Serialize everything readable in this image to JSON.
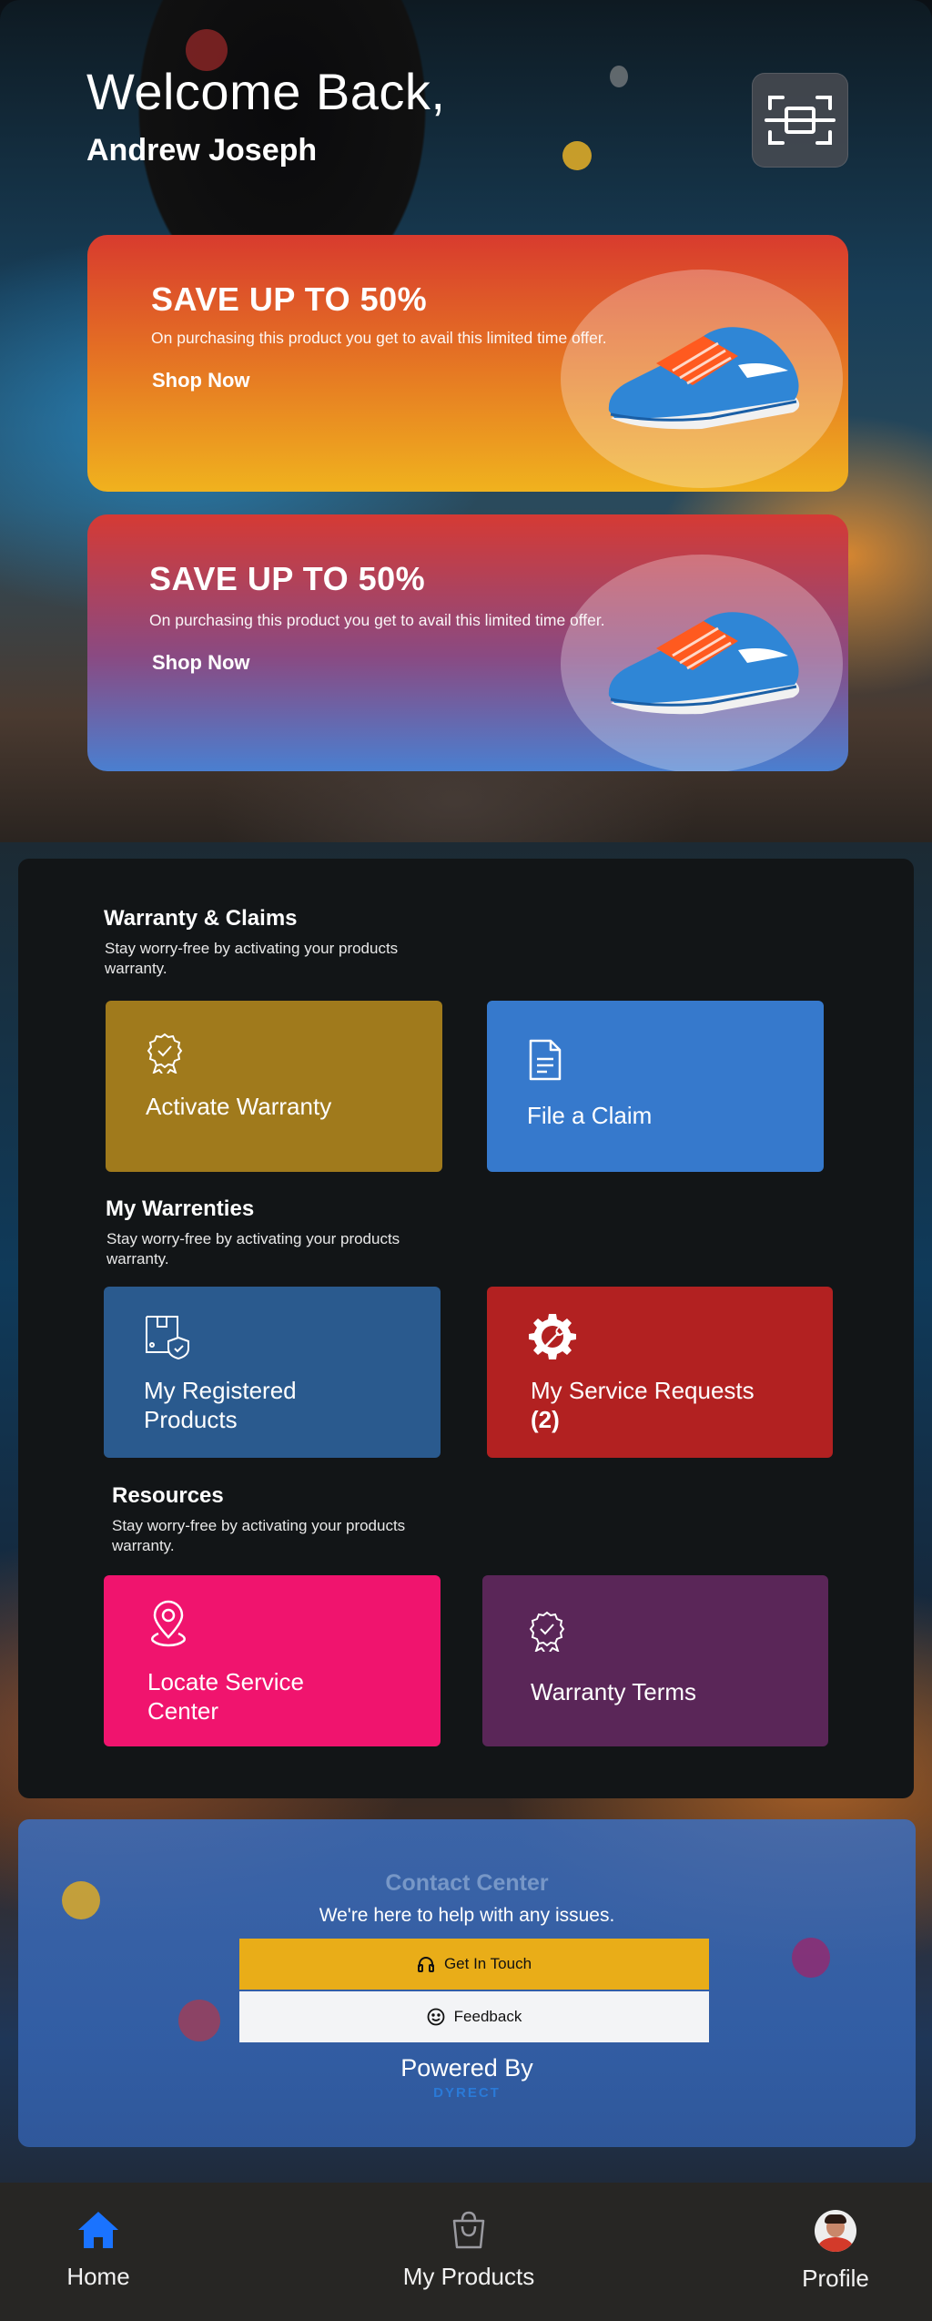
{
  "header": {
    "greeting": "Welcome Back,",
    "user_name": "Andrew Joseph",
    "scan_icon": "scan-icon"
  },
  "promos": [
    {
      "title": "SAVE UP TO 50%",
      "subtitle": "On purchasing this product you get to avail this limited time offer.",
      "cta": "Shop Now",
      "image": "running-shoe"
    },
    {
      "title": "SAVE UP TO 50%",
      "subtitle": "On purchasing this product you get to avail this limited time offer.",
      "cta": "Shop Now",
      "image": "running-shoe"
    }
  ],
  "warranty_claims": {
    "title": "Warranty & Claims",
    "subtitle": "Stay worry-free by activating your products warranty.",
    "tiles": [
      {
        "label": "Activate Warranty",
        "icon": "award-badge-icon",
        "color": "#a07a1c"
      },
      {
        "label": "File a Claim",
        "icon": "document-icon",
        "color": "#3679cc"
      }
    ]
  },
  "my_warranties": {
    "title": "My Warrenties",
    "subtitle": "Stay worry-free by activating your products warranty.",
    "tiles": [
      {
        "label": "My Registered Products",
        "icon": "box-shield-icon",
        "color": "#2a5a8e"
      },
      {
        "label_main": "My Service Requests",
        "label_count": "(2)",
        "icon": "gear-wrench-icon",
        "color": "#b22121"
      }
    ]
  },
  "resources": {
    "title": "Resources",
    "subtitle": "Stay worry-free by activating your products warranty.",
    "tiles": [
      {
        "label": "Locate Service Center",
        "icon": "map-pin-icon",
        "color": "#f0146e"
      },
      {
        "label": "Warranty Terms",
        "icon": "award-badge-icon",
        "color": "#5a2658"
      }
    ]
  },
  "contact": {
    "title": "Contact Center",
    "subtitle": "We're here to help with any issues.",
    "get_in_touch": "Get In Touch",
    "feedback": "Feedback",
    "powered_by": "Powered By",
    "brand": "DYRECT",
    "colors": {
      "get_in_touch": "#e9ad18",
      "feedback": "#f3f4f6"
    }
  },
  "nav": {
    "items": [
      {
        "label": "Home",
        "icon": "home-icon",
        "active": true
      },
      {
        "label": "My Products",
        "icon": "shopping-bag-icon",
        "active": false
      },
      {
        "label": "Profile",
        "icon": "avatar",
        "active": false
      }
    ],
    "active_color": "#1a73ff"
  }
}
